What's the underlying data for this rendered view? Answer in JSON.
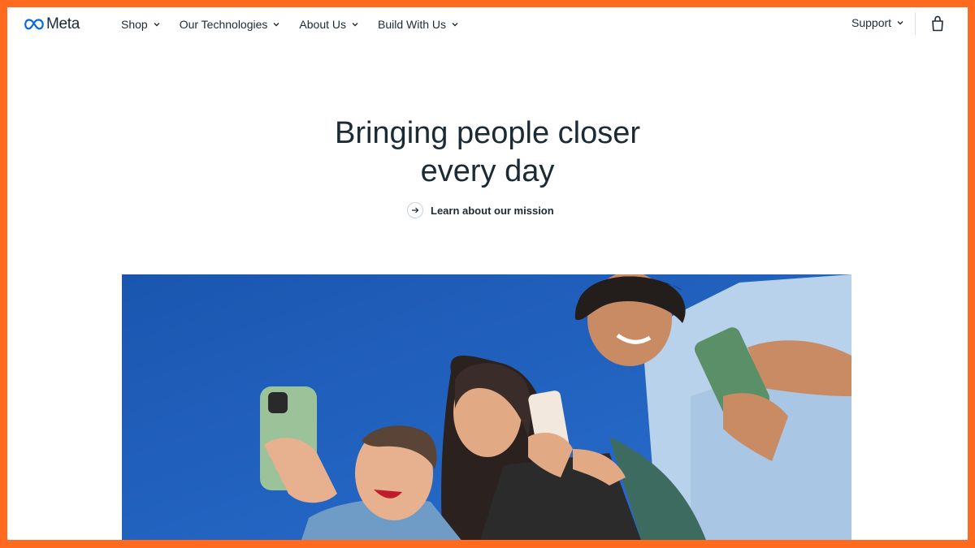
{
  "brand": {
    "name": "Meta"
  },
  "nav": {
    "items": [
      {
        "label": "Shop"
      },
      {
        "label": "Our Technologies"
      },
      {
        "label": "About Us"
      },
      {
        "label": "Build With Us"
      }
    ],
    "support_label": "Support"
  },
  "hero": {
    "title_line1": "Bringing people closer",
    "title_line2": "every day",
    "cta_label": "Learn about our mission"
  },
  "colors": {
    "frame_border": "#ff6a1f",
    "text": "#1c2b33",
    "sky": "#1f5fb8",
    "logo_blue": "#0668e1"
  },
  "icons": {
    "logo": "meta-infinity-logo",
    "chevron": "chevron-down-icon",
    "bag": "shopping-bag-icon",
    "arrow": "arrow-right-icon"
  }
}
